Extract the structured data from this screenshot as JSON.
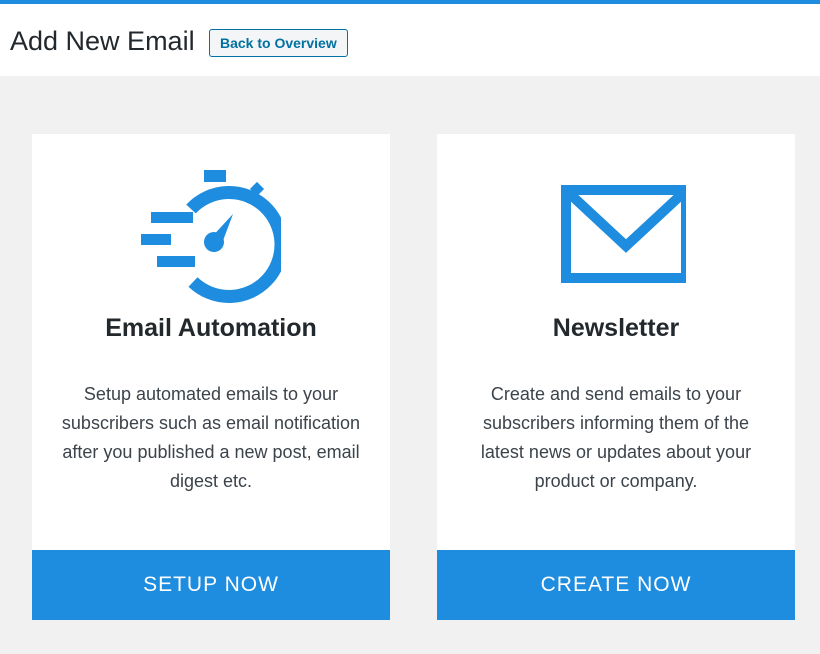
{
  "header": {
    "title": "Add New Email",
    "back_button_label": "Back to Overview"
  },
  "colors": {
    "accent": "#1e8cdf",
    "title_text": "#23282d",
    "body_text": "#3c434a",
    "background": "#f1f1f1"
  },
  "cards": [
    {
      "icon": "stopwatch-icon",
      "title": "Email Automation",
      "description": "Setup automated emails to your subscribers such as email notification after you published a new post, email digest etc.",
      "button_label": "SETUP NOW"
    },
    {
      "icon": "envelope-icon",
      "title": "Newsletter",
      "description": "Create and send emails to your subscribers informing them of the latest news or updates about your product or company.",
      "button_label": "CREATE NOW"
    }
  ]
}
